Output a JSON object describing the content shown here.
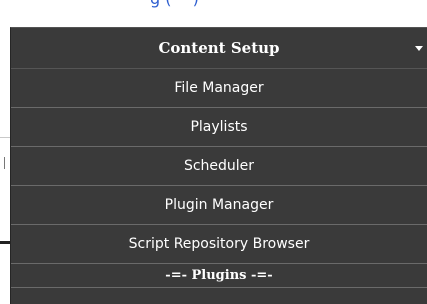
{
  "background": {
    "top_link_text": "g (—    )"
  },
  "menu": {
    "title": "Content Setup",
    "caret_icon": "caret-down-icon",
    "items": [
      {
        "label": "File Manager"
      },
      {
        "label": "Playlists"
      },
      {
        "label": "Scheduler"
      },
      {
        "label": "Plugin Manager"
      },
      {
        "label": "Script Repository Browser"
      }
    ],
    "section_label": "-=- Plugins -=-"
  },
  "colors": {
    "menu_background": "#3a3a3a",
    "menu_text": "#ffffff",
    "divider": "#6a6a6a",
    "link": "#2f5fd0"
  }
}
